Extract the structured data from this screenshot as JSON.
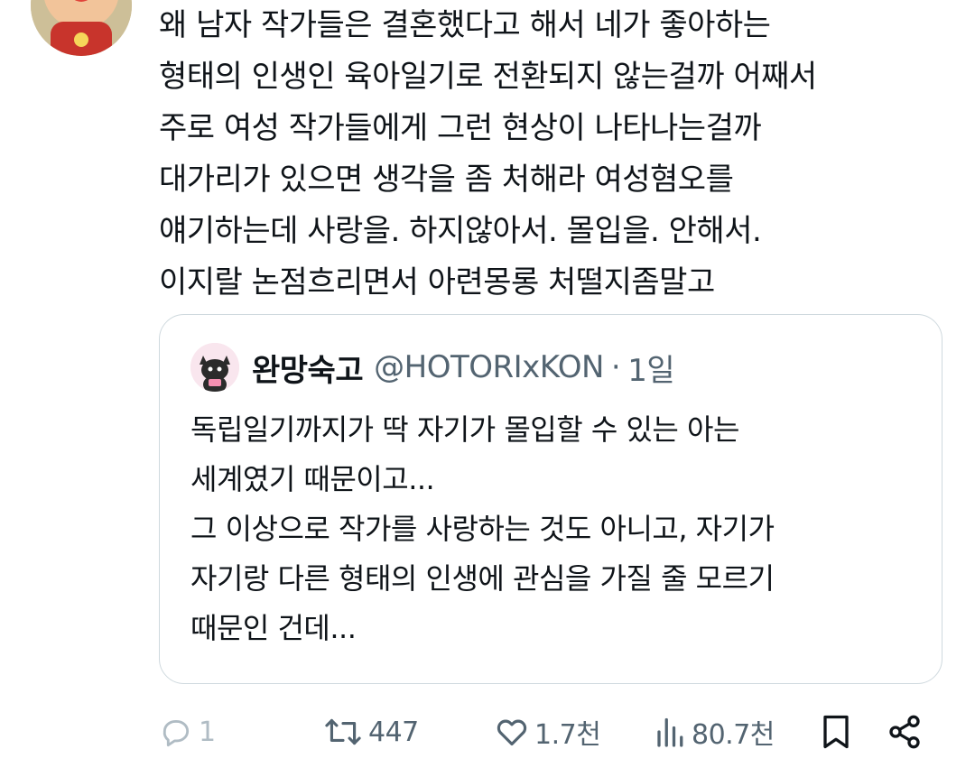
{
  "tweet": {
    "lines": [
      "왜 남자 작가들은 결혼했다고 해서 네가 좋아하는",
      "형태의 인생인 육아일기로 전환되지 않는걸까 어째서",
      "주로 여성 작가들에게 그런 현상이 나타나는걸까",
      "대가리가 있으면 생각을 좀 처해라 여성혐오를",
      "얘기하는데 사랑을. 하지않아서. 몰입을. 안해서.",
      "이지랄 논점흐리면서 아련몽롱 처떨지좀말고"
    ]
  },
  "quote": {
    "name": "완망숙고",
    "handle": "@HOTORIxKON",
    "separator": "·",
    "time": "1일",
    "lines": [
      "독립일기까지가 딱 자기가 몰입할 수 있는 아는",
      "세계였기 때문이고...",
      "그 이상으로 작가를 사랑하는 것도 아니고, 자기가",
      "자기랑 다른 형태의 인생에 관심을 가질 줄 모르기",
      "때문인 건데..."
    ]
  },
  "actions": {
    "reply_count": "1",
    "retweet_count": "447",
    "like_count": "1.7천",
    "view_count": "80.7천"
  },
  "icons": {
    "reply": "reply-icon",
    "retweet": "retweet-icon",
    "like": "heart-icon",
    "views": "views-icon",
    "bookmark": "bookmark-icon",
    "share": "share-icon"
  },
  "colors": {
    "text": "#0f1419",
    "secondary": "#536471",
    "border": "#cfd9de"
  }
}
